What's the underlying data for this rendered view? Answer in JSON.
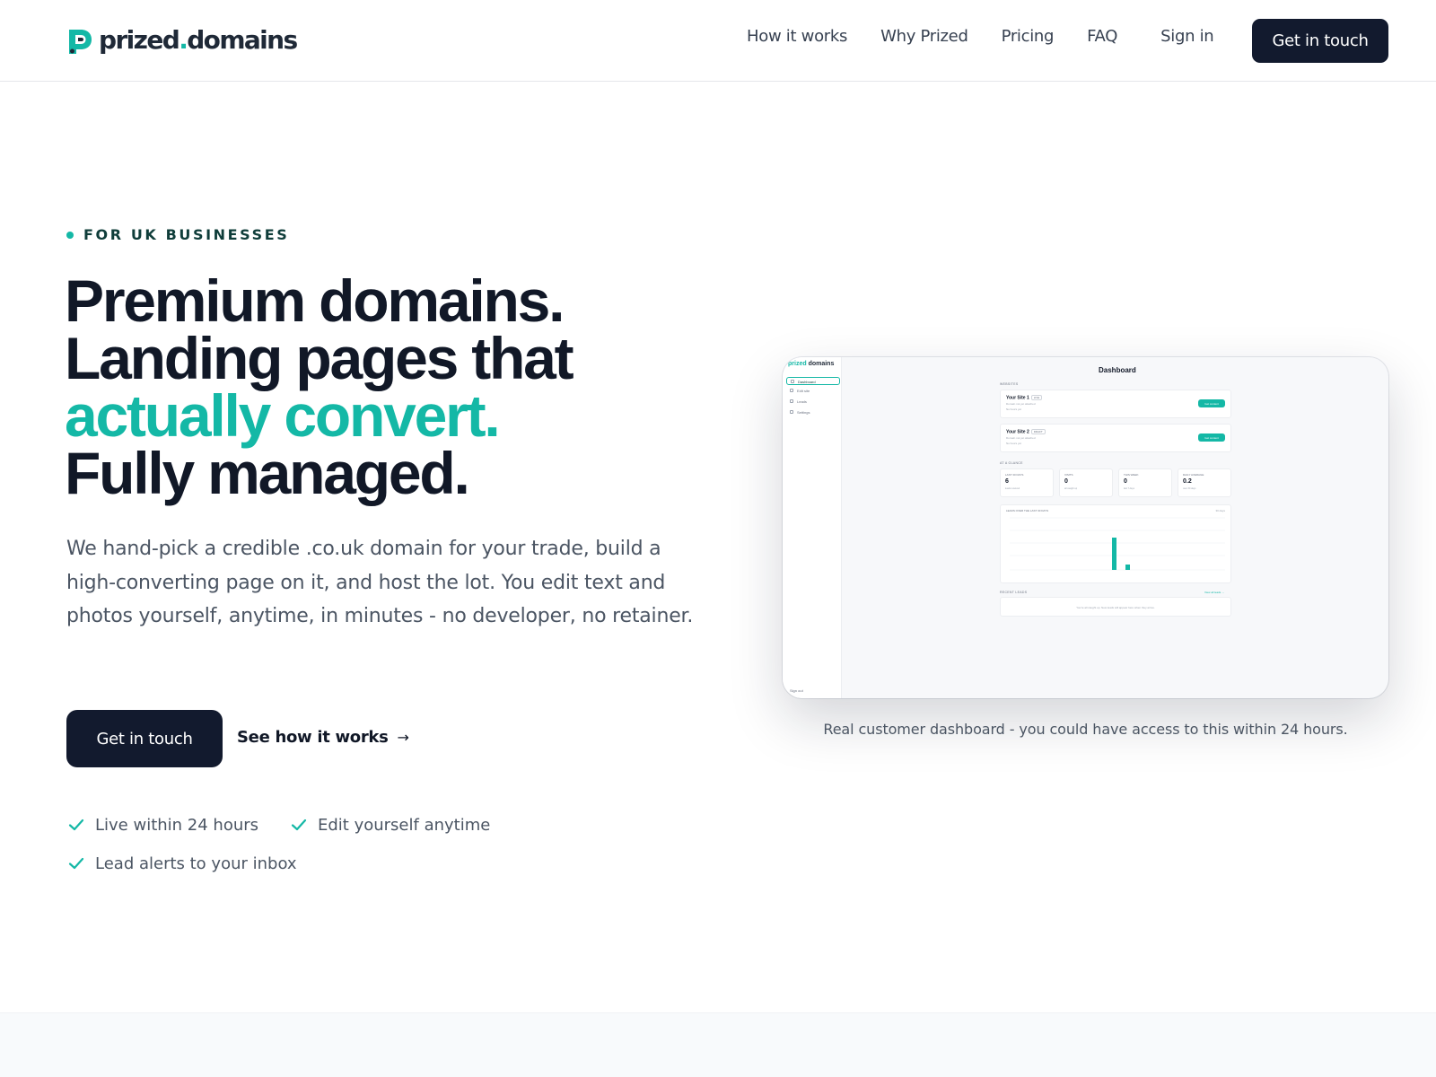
{
  "brand": {
    "name_prefix": "prized",
    "name_dot": ".",
    "name_suffix": "domains",
    "accent_color": "#14b8a6",
    "dark_color": "#121a2e"
  },
  "nav": {
    "items": [
      "How it works",
      "Why Prized",
      "Pricing",
      "FAQ"
    ],
    "sign_in": "Sign in",
    "cta": "Get in touch"
  },
  "hero": {
    "eyebrow": "FOR UK BUSINESSES",
    "headline": [
      "Premium domains.",
      "Landing pages that",
      "actually convert.",
      "Fully managed."
    ],
    "lede": "We hand-pick a credible .co.uk domain for your trade, build a high-converting page on it, and host the lot. You edit text and photos yourself, anytime, in minutes - no developer, no retainer.",
    "cta_primary": "Get in touch",
    "cta_secondary": "See how it works",
    "cta_secondary_arrow": "→",
    "checks": [
      "Live within 24 hours",
      "Edit yourself anytime",
      "Lead alerts to your inbox"
    ]
  },
  "preview": {
    "logo_prefix": "prized",
    "logo_suffix": " domains",
    "nav": [
      "Dashboard",
      "Edit site",
      "Leads",
      "Settings"
    ],
    "sign_out": "Sign out",
    "title": "Dashboard",
    "sites_label": "WEBSITES",
    "sites": [
      {
        "name": "Your Site 1",
        "badge": "LIVE",
        "line1": "Domain not yet attached",
        "line2": "No hours yet",
        "button": "Get content"
      },
      {
        "name": "Your Site 2",
        "badge": "DRAFT",
        "line1": "Domain not yet attached",
        "line2": "No hours yet",
        "button": "Get content"
      }
    ],
    "stats_label": "AT A GLANCE",
    "stats": [
      {
        "title": "LAST 30 DAYS",
        "value": "6",
        "sub": "leads received"
      },
      {
        "title": "VISITS",
        "value": "0",
        "sub": "all caught up"
      },
      {
        "title": "THIS WEEK",
        "value": "0",
        "sub": "last 7 days"
      },
      {
        "title": "DAILY AVERAGE",
        "value": "0.2",
        "sub": "over 30 days"
      }
    ],
    "chart_title": "LEADS OVER THE LAST 30 DAYS",
    "chart_range": "30 days",
    "recent_label": "RECENT LEADS",
    "recent_link": "View all leads →",
    "recent_empty": "You're all caught up. New leads will appear here when they arrive."
  },
  "caption": "Real customer dashboard - you could have access to this within 24 hours."
}
